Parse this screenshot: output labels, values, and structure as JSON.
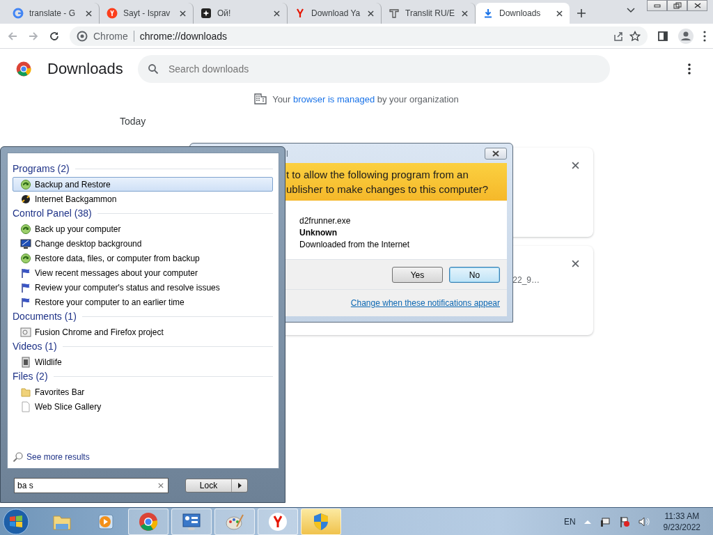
{
  "browser": {
    "tabs": [
      {
        "title": "translate - G",
        "kind": "google",
        "selected": false
      },
      {
        "title": "Sayt - Isprav",
        "kind": "yandex",
        "selected": false
      },
      {
        "title": "Ой!",
        "kind": "star",
        "selected": false
      },
      {
        "title": "Download Ya",
        "kind": "y",
        "selected": false
      },
      {
        "title": "Translit RU/E",
        "kind": "translit",
        "selected": false
      },
      {
        "title": "Downloads",
        "kind": "download",
        "selected": true
      }
    ],
    "site_chip": "Chrome",
    "url": "chrome://downloads"
  },
  "page": {
    "title": "Downloads",
    "search_placeholder": "Search downloads",
    "managed_notice": {
      "before": "Your",
      "link": "browser is managed",
      "after": "by your organization"
    },
    "date_heading": "Today",
    "downloads": [
      {
        "kind": "covered"
      },
      {
        "kind": "partial",
        "file_fragment": "22_9…"
      }
    ]
  },
  "uac_dialog": {
    "title": "l",
    "question": [
      "t to allow the following program from an",
      "ublisher to make changes to this computer?"
    ],
    "program": "d2frunner.exe",
    "publisher": "Unknown",
    "origin": "Downloaded from the Internet",
    "buttons": [
      {
        "label": "Yes",
        "default": false
      },
      {
        "label": "No",
        "default": true
      }
    ],
    "link": "Change when these notifications appear"
  },
  "start_menu": {
    "groups": [
      {
        "title": "Programs (2)",
        "items": [
          {
            "label": "Backup and Restore",
            "kind": "backup",
            "selected": true
          },
          {
            "label": "Internet Backgammon",
            "kind": "game",
            "selected": false
          }
        ]
      },
      {
        "title": "Control Panel (38)",
        "items": [
          {
            "label": "Back up your computer",
            "kind": "backup",
            "selected": false
          },
          {
            "label": "Change desktop background",
            "kind": "monitor",
            "selected": false
          },
          {
            "label": "Restore data, files, or computer from backup",
            "kind": "backup",
            "selected": false
          },
          {
            "label": "View recent messages about your computer",
            "kind": "flag",
            "selected": false
          },
          {
            "label": "Review your computer's status and resolve issues",
            "kind": "flag",
            "selected": false
          },
          {
            "label": "Restore your computer to an earlier time",
            "kind": "flag",
            "selected": false
          }
        ]
      },
      {
        "title": "Documents (1)",
        "items": [
          {
            "label": "Fusion Chrome and Firefox project",
            "kind": "document",
            "selected": false
          }
        ]
      },
      {
        "title": "Videos (1)",
        "items": [
          {
            "label": "Wildlife",
            "kind": "video",
            "selected": false
          }
        ]
      },
      {
        "title": "Files (2)",
        "items": [
          {
            "label": "Favorites Bar",
            "kind": "folder",
            "selected": false
          },
          {
            "label": "Web Slice Gallery",
            "kind": "file",
            "selected": false
          }
        ]
      }
    ],
    "see_more": "See more results",
    "search_value": "ba s",
    "power_button": "Lock"
  },
  "taskbar": {
    "items": [
      {
        "kind": "explorer",
        "running": false,
        "highlighted": false
      },
      {
        "kind": "media",
        "running": false,
        "highlighted": false
      },
      {
        "kind": "chrome",
        "running": true,
        "highlighted": false
      },
      {
        "kind": "panel",
        "running": true,
        "highlighted": false
      },
      {
        "kind": "paint",
        "running": true,
        "highlighted": false
      },
      {
        "kind": "yandex",
        "running": true,
        "highlighted": false
      },
      {
        "kind": "shield",
        "running": true,
        "highlighted": true
      }
    ],
    "language": "EN",
    "time": "11:33 AM",
    "date": "9/23/2022"
  }
}
